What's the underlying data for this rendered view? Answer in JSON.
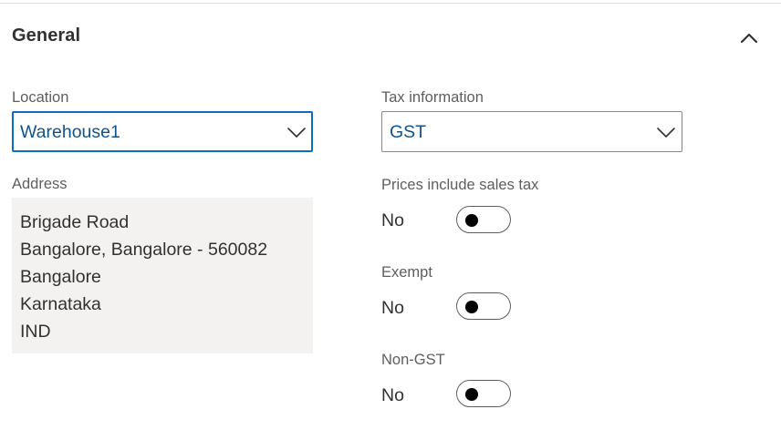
{
  "section": {
    "title": "General",
    "collapse_icon": "chevron-up-icon"
  },
  "location": {
    "label": "Location",
    "value": "Warehouse1",
    "icon": "chevron-down-icon"
  },
  "tax_information": {
    "label": "Tax information",
    "value": "GST",
    "icon": "chevron-down-icon"
  },
  "address": {
    "label": "Address",
    "lines": [
      "Brigade Road",
      "Bangalore, Bangalore - 560082",
      "Bangalore",
      "Karnataka",
      "IND"
    ]
  },
  "prices_include_sales_tax": {
    "label": "Prices include sales tax",
    "value": "No"
  },
  "exempt": {
    "label": "Exempt",
    "value": "No"
  },
  "non_gst": {
    "label": "Non-GST",
    "value": "No"
  },
  "colors": {
    "accent": "#0f6cbd",
    "value_text": "#0f548c",
    "label_text": "#605e5c",
    "readonly_background": "#f3f2f1"
  }
}
